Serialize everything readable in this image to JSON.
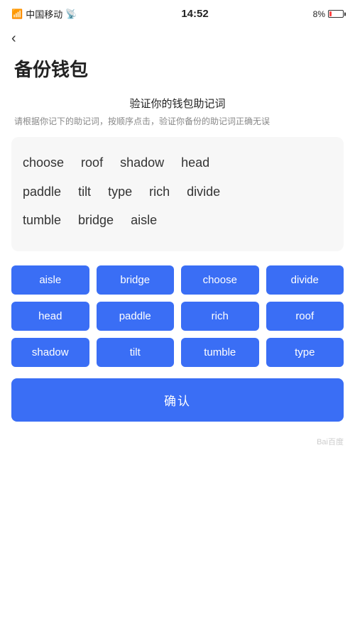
{
  "statusBar": {
    "carrier": "中国移动",
    "time": "14:52",
    "battery": "8%"
  },
  "back": "‹",
  "pageTitle": "备份钱包",
  "instruction": {
    "title": "验证你的钱包助记词",
    "desc": "请根据你记下的助记词，按顺序点击，验证你备份的助记词正确无误"
  },
  "displayWords": [
    "choose",
    "roof",
    "shadow",
    "head",
    "paddle",
    "tilt",
    "type",
    "rich",
    "divide",
    "tumble",
    "bridge",
    "aisle"
  ],
  "wordButtons": [
    "aisle",
    "bridge",
    "choose",
    "divide",
    "head",
    "paddle",
    "rich",
    "roof",
    "shadow",
    "tilt",
    "tumble",
    "type"
  ],
  "confirmLabel": "确认",
  "watermark": "Bai百度"
}
